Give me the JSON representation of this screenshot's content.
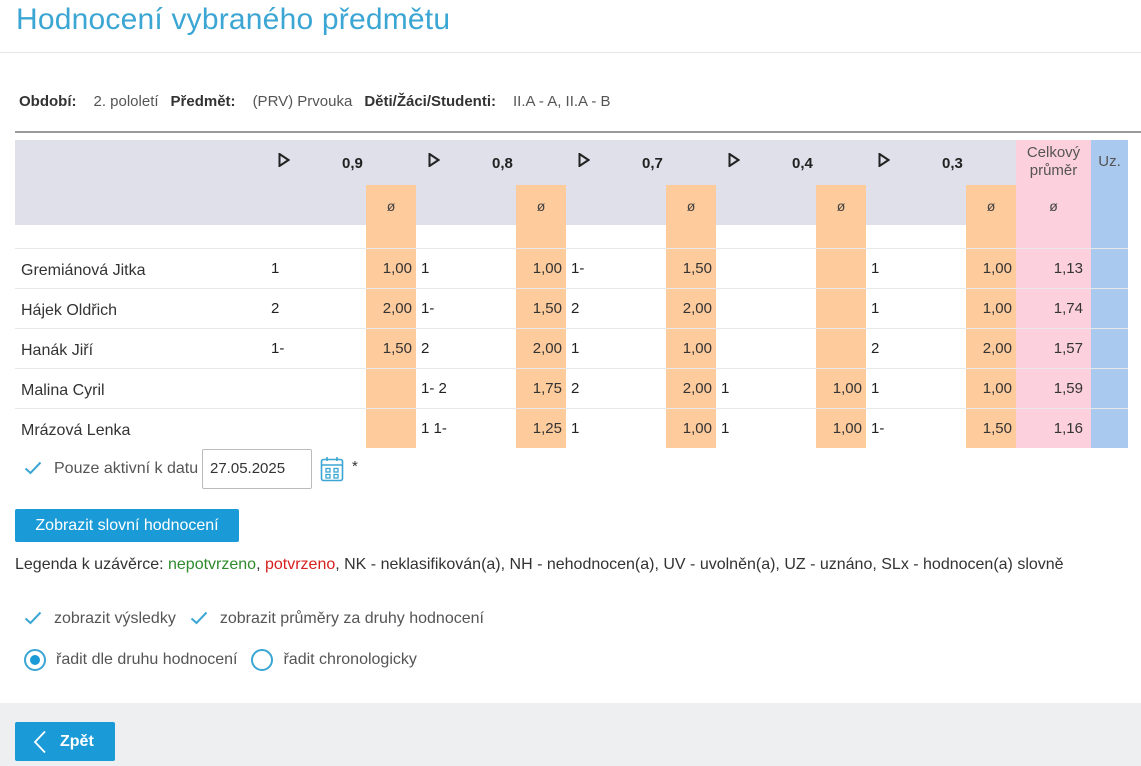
{
  "page": {
    "title": "Hodnocení vybraného předmětu"
  },
  "info": {
    "period_label": "Období:",
    "period_value": "2. pololetí",
    "subject_label": "Předmět:",
    "subject_value": "(PRV) Prvouka",
    "students_label": "Děti/Žáci/Studenti:",
    "students_value": "II.A - A, II.A - B"
  },
  "table": {
    "flag_icon": "triangle-flag-icon",
    "weights": [
      "0,9",
      "0,8",
      "0,7",
      "0,4",
      "0,3"
    ],
    "avg_symbol": "ø",
    "total_header": "Celkový průměr",
    "uz_header": "Uz.",
    "rows": [
      {
        "name": "Gremiánová Jitka",
        "grades": [
          "1",
          "1",
          "1-",
          "",
          "1"
        ],
        "avgs": [
          "1,00",
          "1,00",
          "1,50",
          "",
          "1,00"
        ],
        "total": "1,13"
      },
      {
        "name": "Hájek Oldřich",
        "grades": [
          "2",
          "1-",
          "2",
          "",
          "1"
        ],
        "avgs": [
          "2,00",
          "1,50",
          "2,00",
          "",
          "1,00"
        ],
        "total": "1,74"
      },
      {
        "name": "Hanák Jiří",
        "grades": [
          "1-",
          "2",
          "1",
          "",
          "2"
        ],
        "avgs": [
          "1,50",
          "2,00",
          "1,00",
          "",
          "2,00"
        ],
        "total": "1,57"
      },
      {
        "name": "Malina Cyril",
        "grades": [
          "",
          "1- 2",
          "2",
          "1",
          "1"
        ],
        "avgs": [
          "",
          "1,75",
          "2,00",
          "1,00",
          "1,00"
        ],
        "total": "1,59"
      },
      {
        "name": "Mrázová Lenka",
        "grades": [
          "",
          "1 1-",
          "1",
          "1",
          "1-"
        ],
        "avgs": [
          "",
          "1,25",
          "1,00",
          "1,00",
          "1,50"
        ],
        "total": "1,16"
      }
    ]
  },
  "filter": {
    "active_label": "Pouze aktivní k datu",
    "date_value": "27.05.2025",
    "asterisk": "*"
  },
  "buttons": {
    "verbal": "Zobrazit slovní hodnocení",
    "back": "Zpět"
  },
  "legend": {
    "prefix": "Legenda k uzávěrce:",
    "unconfirmed": "nepotvrzeno",
    "separator": ",",
    "confirmed": "potvrzeno",
    "rest": ", NK - neklasifikován(a), NH - nehodnocen(a), UV - uvolněn(a), UZ - uznáno, SLx - hodnocen(a) slovně"
  },
  "options": {
    "show_results": "zobrazit výsledky",
    "show_averages": "zobrazit průměry za druhy hodnocení",
    "sort_by_type": "řadit dle druhu hodnocení",
    "sort_chrono": "řadit chronologicky",
    "selected_sort": "řadit dle druhu hodnocení"
  },
  "colors": {
    "accent": "#1a9bd7",
    "title": "#3ba6d3",
    "avg_col": "#fdcb9c",
    "total_col": "#fcd0dc",
    "uz_col": "#a9caee",
    "header": "#dfe0ea"
  }
}
